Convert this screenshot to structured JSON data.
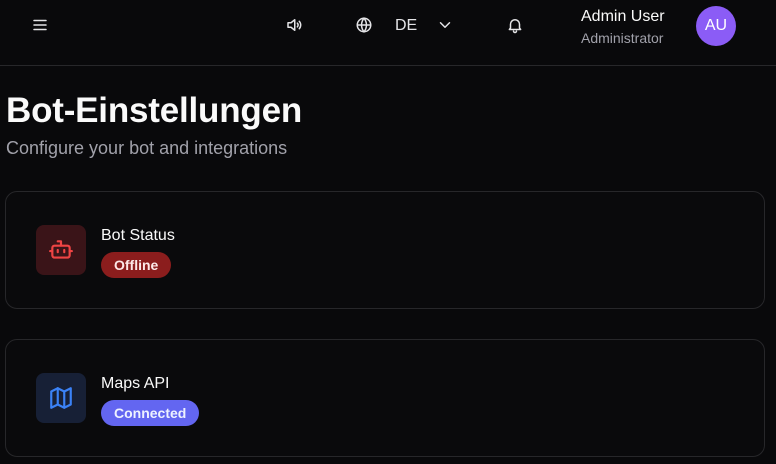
{
  "header": {
    "menu_icon": "hamburger-menu-icon",
    "sound_icon": "speaker-icon",
    "globe_icon": "globe-icon",
    "language": "DE",
    "language_chevron_icon": "chevron-down-icon",
    "bell_icon": "bell-icon",
    "user": {
      "name": "Admin User",
      "role": "Administrator",
      "avatar_initials": "AU",
      "avatar_color": "#8b5cf6"
    }
  },
  "page": {
    "title": "Bot-Einstellungen",
    "subtitle": "Configure your bot and integrations"
  },
  "cards": [
    {
      "title": "Bot Status",
      "icon": "bot-icon",
      "badge": "Offline",
      "badge_color": "#8b1d1d",
      "icon_color": "#ef4444"
    },
    {
      "title": "Maps API",
      "icon": "map-icon",
      "badge": "Connected",
      "badge_color": "#6366f1",
      "icon_color": "#3b82f6"
    }
  ]
}
